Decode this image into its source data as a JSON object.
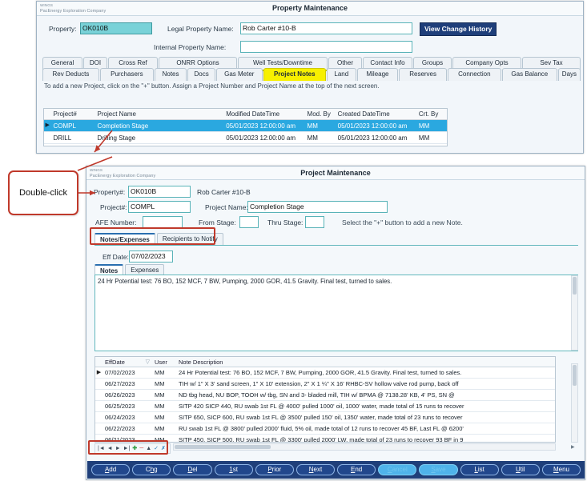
{
  "colors": {
    "accent_navy": "#1f3f7a",
    "select_blue": "#2aa8e0",
    "field_teal": "#59b3b8",
    "tab_yellow": "#f7f000",
    "tab_green": "#b5c400",
    "annotation_red": "#c0392b"
  },
  "property_window": {
    "brand_line1": "WINGS",
    "brand_line2": "PacEnergy Exploration Company",
    "title": "Property Maintenance",
    "fields": {
      "property_label": "Property:",
      "property_value": "OK010B",
      "legal_name_label": "Legal Property Name:",
      "legal_name_value": "Rob Carter #10-B",
      "internal_name_label": "Internal Property Name:",
      "internal_name_value": ""
    },
    "view_change_history_button": "View Change History",
    "tabs_row1": [
      {
        "label": "General",
        "state": "normal"
      },
      {
        "label": "DOI",
        "state": "normal"
      },
      {
        "label": "Cross Ref",
        "state": "normal"
      },
      {
        "label": "ONRR Options",
        "state": "normal"
      },
      {
        "label": "Well Tests/Downtime",
        "state": "green-underline"
      },
      {
        "label": "Other",
        "state": "normal"
      },
      {
        "label": "Contact Info",
        "state": "normal"
      },
      {
        "label": "Groups",
        "state": "normal"
      },
      {
        "label": "Company Opts",
        "state": "normal"
      },
      {
        "label": "Sev Tax",
        "state": "normal"
      }
    ],
    "tabs_row2": [
      {
        "label": "Rev Deducts",
        "state": "normal"
      },
      {
        "label": "Purchasers",
        "state": "normal"
      },
      {
        "label": "Notes",
        "state": "normal"
      },
      {
        "label": "Docs",
        "state": "normal"
      },
      {
        "label": "Gas Meter",
        "state": "normal"
      },
      {
        "label": "Project Notes",
        "state": "selected-yellow"
      },
      {
        "label": "Land",
        "state": "normal"
      },
      {
        "label": "Mileage",
        "state": "normal"
      },
      {
        "label": "Reserves",
        "state": "normal"
      },
      {
        "label": "Connection",
        "state": "normal"
      },
      {
        "label": "Gas Balance",
        "state": "normal"
      },
      {
        "label": "Days",
        "state": "normal"
      }
    ],
    "hint": "To add a new Project, click on the \"+\" button.  Assign a Project Number and Project Name at the top of the next screen.",
    "grid": {
      "columns": [
        "Project#",
        "Project Name",
        "Modified DateTime",
        "Mod. By",
        "Created DateTime",
        "Crt. By"
      ],
      "rows": [
        {
          "selected": true,
          "cells": [
            "COMPL",
            "Completion Stage",
            "05/01/2023 12:00:00 am",
            "MM",
            "05/01/2023 12:00:00 am",
            "MM"
          ]
        },
        {
          "selected": false,
          "cells": [
            "DRILL",
            "Drilling Stage",
            "05/01/2023 12:00:00 am",
            "MM",
            "05/01/2023 12:00:00 am",
            "MM"
          ]
        }
      ]
    }
  },
  "project_window": {
    "brand_line1": "WINGS",
    "brand_line2": "PacEnergy Exploration Company",
    "title": "Project Maintenance",
    "fields": {
      "property_label": "Property#:",
      "property_value": "OK010B",
      "property_name_text": "Rob Carter #10-B",
      "project_label": "Project#:",
      "project_value": "COMPL",
      "project_name_label": "Project Name:",
      "project_name_value": "Completion Stage",
      "afe_label": "AFE Number:",
      "afe_value": "",
      "from_stage_label": "From Stage:",
      "from_stage_value": "",
      "thru_stage_label": "Thru Stage:",
      "thru_stage_value": "",
      "note_hint": "Select the \"+\" button to add a new Note.",
      "eff_date_label": "Eff Date:",
      "eff_date_value": "07/02/2023"
    },
    "main_tabs": [
      {
        "label": "Notes/Expenses",
        "active": true
      },
      {
        "label": "Recipients to Notify",
        "active": false
      }
    ],
    "inner_tabs": [
      {
        "label": "Notes",
        "active": true
      },
      {
        "label": "Expenses",
        "active": false
      }
    ],
    "note_text": "24 Hr Potential test:  76 BO, 152 MCF, 7 BW, Pumping, 2000 GOR, 41.5 Gravity.  Final test, turned to sales.",
    "note_grid": {
      "columns": [
        "EffDate",
        "User",
        "Note Description"
      ],
      "sort_indicator": "▽",
      "rows": [
        {
          "current": true,
          "effdate": "07/02/2023",
          "user": "MM",
          "desc": "24 Hr Potential test:  76 BO, 152 MCF, 7 BW, Pumping, 2000 GOR, 41.5 Gravity.  Final test, turned to sales."
        },
        {
          "current": false,
          "effdate": "06/27/2023",
          "user": "MM",
          "desc": "TIH w/ 1\" X 3' sand screen, 1\" X 10' extension, 2\" X 1 ¼\" X 16' RHBC-SV hollow valve rod pump, back off"
        },
        {
          "current": false,
          "effdate": "06/26/2023",
          "user": "MM",
          "desc": "ND tbg head, NU BOP, TOOH w/ tbg, SN and 3- bladed mill, TIH w/ BPMA @ 7138.28' KB, 4' PS, SN @"
        },
        {
          "current": false,
          "effdate": "06/25/2023",
          "user": "MM",
          "desc": "SITP 420 SICP 440, RU swab 1st FL @ 4000' pulled 1000' oil, 1000' water, made total of 15 runs to recover"
        },
        {
          "current": false,
          "effdate": "06/24/2023",
          "user": "MM",
          "desc": "SITP 650, SICP 600, RU swab 1st FL @ 3500' pulled 150' oil, 1350' water, made total of 23 runs to recover"
        },
        {
          "current": false,
          "effdate": "06/22/2023",
          "user": "MM",
          "desc": "RU swab 1st FL @ 3800' pulled 2000' fluid, 5% oil, made total of 12 runs to recover 45 BF, Last FL @ 6200'"
        },
        {
          "current": false,
          "effdate": "06/21/2023",
          "user": "MM",
          "desc": "SITP 450, SICP 500, RU swab 1st FL @ 3300' pulled 2000' LW, made total of 23 runs to recover 93 BF in 9"
        }
      ]
    },
    "navigator": [
      {
        "name": "first-record",
        "glyph": "|◄"
      },
      {
        "name": "prior-record",
        "glyph": "◄"
      },
      {
        "name": "next-record",
        "glyph": "►"
      },
      {
        "name": "last-record",
        "glyph": "►|"
      },
      {
        "name": "insert-record",
        "glyph": "✚"
      },
      {
        "name": "delete-record",
        "glyph": "─"
      },
      {
        "name": "edit-record",
        "glyph": "▲"
      },
      {
        "name": "post-record",
        "glyph": "✓"
      },
      {
        "name": "cancel-record",
        "glyph": "✗"
      }
    ],
    "button_bar": [
      {
        "label": "Add",
        "accel": "A",
        "disabled": false
      },
      {
        "label": "Chg",
        "accel": "h",
        "disabled": false
      },
      {
        "label": "Del",
        "accel": "D",
        "disabled": false
      },
      {
        "label": "1st",
        "accel": "1",
        "disabled": false
      },
      {
        "label": "Prior",
        "accel": "P",
        "disabled": false
      },
      {
        "label": "Next",
        "accel": "N",
        "disabled": false
      },
      {
        "label": "End",
        "accel": "E",
        "disabled": false
      },
      {
        "label": "Cancel",
        "accel": "C",
        "disabled": true
      },
      {
        "label": "Save",
        "accel": "S",
        "disabled": true
      },
      {
        "label": "List",
        "accel": "L",
        "disabled": false
      },
      {
        "label": "Util",
        "accel": "U",
        "disabled": false
      },
      {
        "label": "Menu",
        "accel": "M",
        "disabled": false
      }
    ]
  },
  "annotations": {
    "double_click_label": "Double-click"
  }
}
